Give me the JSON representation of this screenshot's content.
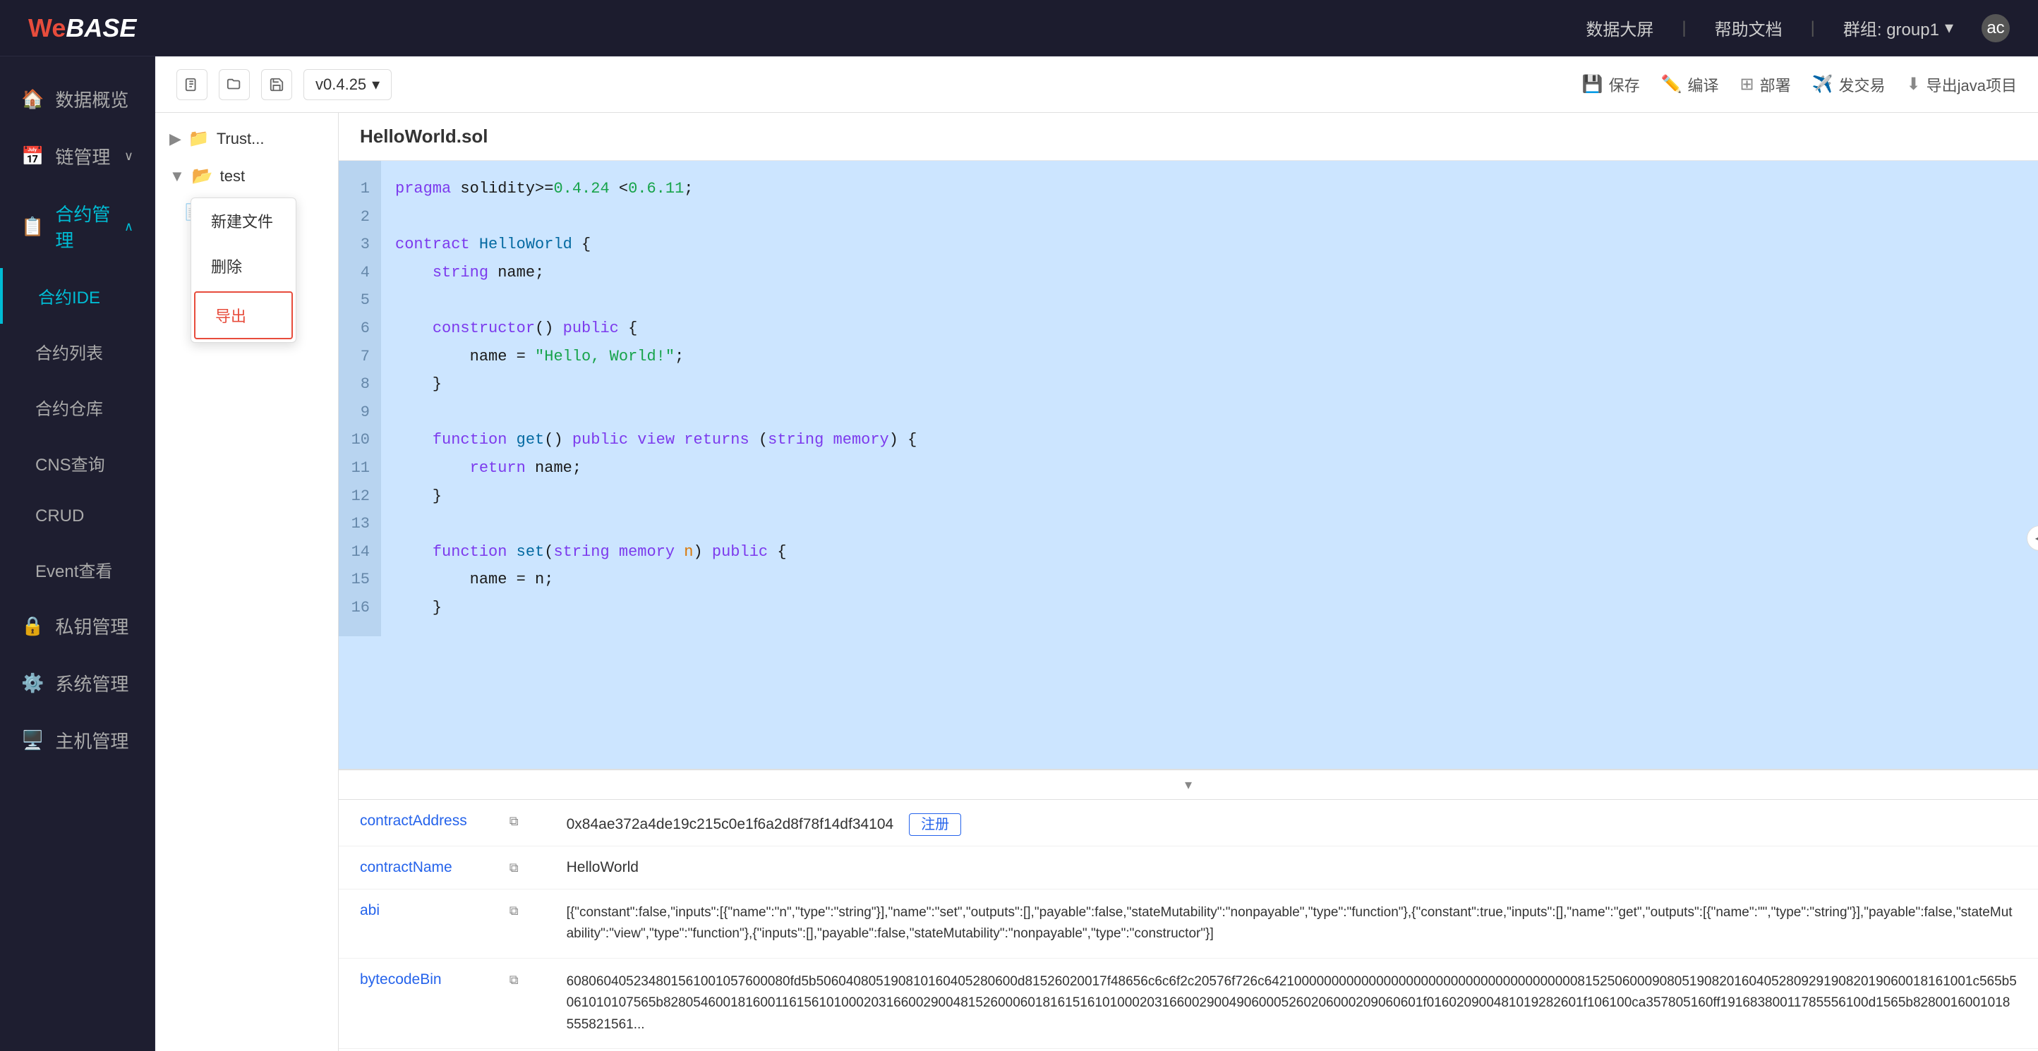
{
  "topNav": {
    "logo": "WeBASE",
    "logoWe": "We",
    "logoBase": "BASE",
    "navItems": [
      "数据大屏",
      "帮助文档"
    ],
    "divider": "|",
    "group": "群组: group1",
    "userIcon": "ac"
  },
  "sidebar": {
    "items": [
      {
        "id": "data-overview",
        "label": "数据概览",
        "icon": "🏠",
        "hasArrow": false
      },
      {
        "id": "chain-mgmt",
        "label": "链管理",
        "icon": "📅",
        "hasArrow": true
      },
      {
        "id": "contract-mgmt",
        "label": "合约管理",
        "icon": "📋",
        "hasArrow": true,
        "active": true
      },
      {
        "id": "contract-ide",
        "label": "合约IDE",
        "icon": "",
        "sub": true,
        "highlighted": true
      },
      {
        "id": "contract-list",
        "label": "合约列表",
        "icon": "",
        "sub": true
      },
      {
        "id": "contract-warehouse",
        "label": "合约仓库",
        "icon": "",
        "sub": true
      },
      {
        "id": "cns-query",
        "label": "CNS查询",
        "icon": "",
        "sub": true
      },
      {
        "id": "crud",
        "label": "CRUD",
        "icon": "",
        "sub": true
      },
      {
        "id": "event-view",
        "label": "Event查看",
        "icon": "",
        "sub": true
      },
      {
        "id": "private-key",
        "label": "私钥管理",
        "icon": "🔒",
        "hasArrow": false
      },
      {
        "id": "system-mgmt",
        "label": "系统管理",
        "icon": "⚙️",
        "hasArrow": false
      },
      {
        "id": "user-mgmt",
        "label": "主机管理",
        "icon": "🖥️",
        "hasArrow": false
      }
    ]
  },
  "ideToolbar": {
    "icons": [
      "new-file",
      "new-folder",
      "save"
    ],
    "version": "v0.4.25",
    "versionArrow": "▾",
    "actions": [
      {
        "id": "save",
        "icon": "💾",
        "label": "保存"
      },
      {
        "id": "compile",
        "icon": "✏️",
        "label": "编译"
      },
      {
        "id": "deploy",
        "icon": "⊞",
        "label": "部署"
      },
      {
        "id": "send-tx",
        "icon": "✈️",
        "label": "发交易"
      },
      {
        "id": "export-java",
        "icon": "⬇",
        "label": "导出java项目"
      }
    ]
  },
  "fileTree": {
    "items": [
      {
        "type": "folder",
        "name": "Trust...",
        "expanded": false,
        "level": 0
      },
      {
        "type": "folder",
        "name": "test",
        "expanded": true,
        "level": 0
      },
      {
        "type": "file",
        "name": "...",
        "level": 1
      }
    ]
  },
  "contextMenu": {
    "items": [
      {
        "id": "new-file",
        "label": "新建文件"
      },
      {
        "id": "delete",
        "label": "删除"
      },
      {
        "id": "export",
        "label": "导出",
        "highlighted": true
      }
    ]
  },
  "codeEditor": {
    "filename": "HelloWorld.sol",
    "lines": [
      {
        "num": 1,
        "code": "pragma solidity>=0.4.24 <0.6.11;"
      },
      {
        "num": 2,
        "code": ""
      },
      {
        "num": 3,
        "code": "contract HelloWorld {"
      },
      {
        "num": 4,
        "code": "    string name;"
      },
      {
        "num": 5,
        "code": ""
      },
      {
        "num": 6,
        "code": "    constructor() public {"
      },
      {
        "num": 7,
        "code": "        name = \"Hello, World!\";"
      },
      {
        "num": 8,
        "code": "    }"
      },
      {
        "num": 9,
        "code": ""
      },
      {
        "num": 10,
        "code": "    function get() public view returns (string memory) {"
      },
      {
        "num": 11,
        "code": "        return name;"
      },
      {
        "num": 12,
        "code": "    }"
      },
      {
        "num": 13,
        "code": ""
      },
      {
        "num": 14,
        "code": "    function set(string memory n) public {"
      },
      {
        "num": 15,
        "code": "        name = n;"
      },
      {
        "num": 16,
        "code": "    }"
      }
    ]
  },
  "bottomPanel": {
    "rows": [
      {
        "field": "contractAddress",
        "copyIcon": true,
        "value": "0x84ae372a4de19c215c0e1f6a2d8f78f14df34104",
        "extra": "注册"
      },
      {
        "field": "contractName",
        "copyIcon": true,
        "value": "HelloWorld",
        "extra": ""
      },
      {
        "field": "abi",
        "copyIcon": true,
        "value": "[{\"constant\":false,\"inputs\":[{\"name\":\"n\",\"type\":\"string\"}],\"name\":\"set\",\"outputs\":[],\"payable\":false,\"stateMutability\":\"nonpayable\",\"type\":\"function\"},{\"constant\":true,\"inputs\":[],\"name\":\"get\",\"outputs\":[{\"name\":\"\",\"type\":\"string\"}],\"payable\":false,\"stateMutability\":\"view\",\"type\":\"function\"},{\"inputs\":[],\"payable\":false,\"stateMutability\":\"nonpayable\",\"type\":\"constructor\"}]",
        "extra": ""
      },
      {
        "field": "bytecodeBin",
        "copyIcon": true,
        "value": "608060405234801561001057600080fd5b506040805190810160405280600d81526020017f48656c6c6f2c20576f726c64210000000000000000000000000000000000000081525060009080519082016040528092919082019060018161001c565b5061010107565b828054600181600116156101000203166002900481526000601816151610100020316600290049060005260206000209060601f016020900481019282601f106100ca357805160ff19168380011785556100d1565b8280016001018555821561...",
        "extra": ""
      }
    ]
  }
}
